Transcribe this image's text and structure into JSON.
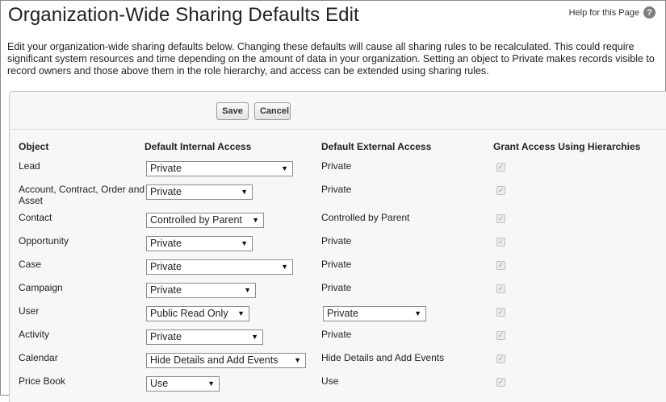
{
  "page": {
    "title": "Organization-Wide Sharing Defaults Edit",
    "help_label": "Help for this Page",
    "help_icon": "?",
    "description": "Edit your organization-wide sharing defaults below. Changing these defaults will cause all sharing rules to be recalculated. This could require significant system resources and time depending on the amount of data in your organization. Setting an object to Private makes records visible to record owners and those above them in the role hierarchy, and access can be extended using sharing rules."
  },
  "buttons": {
    "save": "Save",
    "cancel": "Cancel"
  },
  "columns": {
    "object": "Object",
    "internal": "Default Internal Access",
    "external": "Default External Access",
    "hierarchy": "Grant Access Using Hierarchies"
  },
  "rows": [
    {
      "object": "Lead",
      "internal": "Private",
      "external": "Private",
      "external_is_select": false,
      "grant": true
    },
    {
      "object": "Account, Contract, Order and Asset",
      "internal": "Private",
      "external": "Private",
      "external_is_select": false,
      "grant": true
    },
    {
      "object": "Contact",
      "internal": "Controlled by Parent",
      "external": "Controlled by Parent",
      "external_is_select": false,
      "grant": true
    },
    {
      "object": "Opportunity",
      "internal": "Private",
      "external": "Private",
      "external_is_select": false,
      "grant": true
    },
    {
      "object": "Case",
      "internal": "Private",
      "external": "Private",
      "external_is_select": false,
      "grant": true
    },
    {
      "object": "Campaign",
      "internal": "Private",
      "external": "Private",
      "external_is_select": false,
      "grant": true
    },
    {
      "object": "User",
      "internal": "Public Read Only",
      "external": "Private",
      "external_is_select": true,
      "grant": true
    },
    {
      "object": "Activity",
      "internal": "Private",
      "external": "Private",
      "external_is_select": false,
      "grant": true
    },
    {
      "object": "Calendar",
      "internal": "Hide Details and Add Events",
      "external": "Hide Details and Add Events",
      "external_is_select": false,
      "grant": true
    },
    {
      "object": "Price Book",
      "internal": "Use",
      "external": "Use",
      "external_is_select": false,
      "grant": true
    }
  ]
}
